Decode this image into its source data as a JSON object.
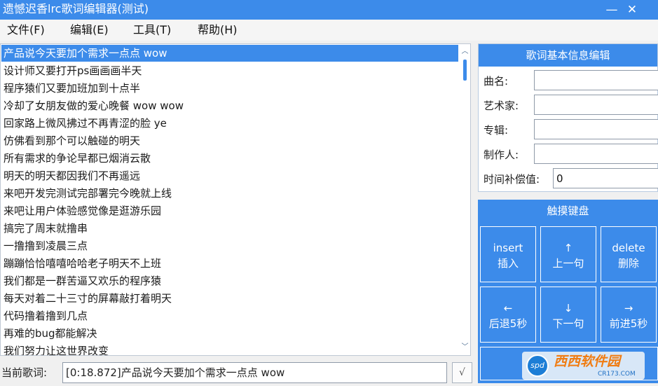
{
  "window": {
    "title": "遗憾迟香lrc歌词编辑器(测试)",
    "minimize_glyph": "—",
    "close_glyph": "✕"
  },
  "menu": [
    {
      "label": "文件(F)"
    },
    {
      "label": "编辑(E)"
    },
    {
      "label": "工具(T)"
    },
    {
      "label": "帮助(H)"
    }
  ],
  "lyrics": {
    "selected_index": 0,
    "items": [
      "产品说今天要加个需求一点点 wow",
      "设计师又要打开ps画画画半天",
      "程序猿们又要加班加到十点半",
      "冷却了女朋友做的爱心晚餐 wow wow",
      "回家路上微风拂过不再青涩的脸 ye",
      "仿佛看到那个可以触碰的明天",
      "所有需求的争论早都已烟消云散",
      "明天的明天都因我们不再遥远",
      "来吧开发完测试完部署完今晚就上线",
      "来吧让用户体验感觉像是逛游乐园",
      "搞完了周末就撸串",
      "一撸撸到凌晨三点",
      "蹦蹦恰恰嘻嘻哈哈老子明天不上班",
      "我们都是一群苦逼又欢乐的程序猿",
      "每天对着二十三寸的屏幕敲打着明天",
      "代码撸着撸到几点",
      "再难的bug都能解决",
      "我们努力让这世界改变"
    ],
    "scroll_up_glyph": "︿",
    "scroll_down_glyph": "﹀"
  },
  "current": {
    "label": "当前歌词:",
    "value": "[0:18.872]产品说今天要加个需求一点点 wow",
    "confirm_label": "√"
  },
  "info": {
    "header": "歌词基本信息编辑",
    "fields": [
      {
        "label": "曲名:",
        "value": ""
      },
      {
        "label": "艺术家:",
        "value": ""
      },
      {
        "label": "专辑:",
        "value": ""
      },
      {
        "label": "制作人:",
        "value": ""
      },
      {
        "label": "时间补偿值:",
        "value": "0"
      }
    ]
  },
  "keyboard": {
    "title": "触摸键盘",
    "keys": [
      {
        "line1": "insert",
        "line2": "插入",
        "name": "insert"
      },
      {
        "line1": "↑",
        "line2": "上一句",
        "name": "previous-line"
      },
      {
        "line1": "delete",
        "line2": "删除",
        "name": "delete"
      },
      {
        "line1": "←",
        "line2": "后退5秒",
        "name": "back-5s"
      },
      {
        "line1": "↓",
        "line2": "下一句",
        "name": "next-line"
      },
      {
        "line1": "→",
        "line2": "前进5秒",
        "name": "forward-5s"
      }
    ]
  },
  "watermark": {
    "badge": "spd",
    "text": "西西软件园",
    "sub": "CR173.COM"
  },
  "colors": {
    "accent": "#3c8bea",
    "selected_text": "#ffffff",
    "window_bg": "#f0f0f0"
  }
}
